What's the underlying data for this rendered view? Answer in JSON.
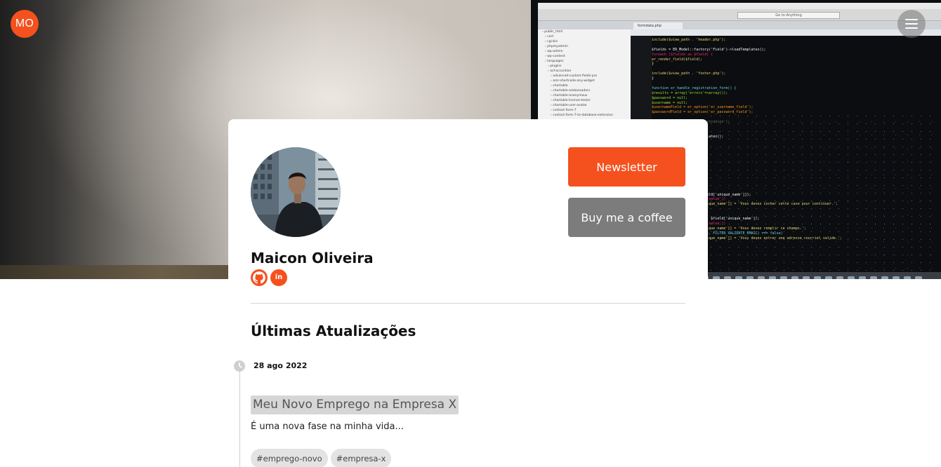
{
  "header": {
    "logo_initials": "MO",
    "menu_icon": "hamburger-menu-icon"
  },
  "hero": {
    "screen_menu": [
      "Komodo",
      "File",
      "Edit",
      "Code",
      "Navigation",
      "View",
      "Project",
      "Tools",
      "Help"
    ],
    "screen_search_placeholder": "Go to Anything",
    "screen_tab": "formdata.php",
    "screen_sidebar": [
      "public_html",
      "cert",
      "cgi-bin",
      "phpmyadmin",
      "wp-admin",
      "wp-content",
      "languages",
      "plugins",
      "acf-accordion",
      "advanced-custom-fields-pro",
      "amr-shortcode-any-widget",
      "chartable",
      "chartable-ambassadors",
      "chartable-anonymous",
      "chartable-license-tester",
      "chartable-user-avatar",
      "contact-form-7",
      "contact-form-7-to-database-extension"
    ],
    "screen_code": [
      {
        "text": "include($view_path . 'header.php');",
        "color": "#e6db74"
      },
      {
        "text": "",
        "color": "#ccc"
      },
      {
        "text": "$fields = ER_Model::factory('Field')->loadTemplates();",
        "color": "#f8f8f2"
      },
      {
        "text": "foreach ($fields as $field) {",
        "color": "#f92672"
      },
      {
        "text": "    er_render_field($field);",
        "color": "#e6db74"
      },
      {
        "text": "}",
        "color": "#f8f8f2"
      },
      {
        "text": "",
        "color": "#ccc"
      },
      {
        "text": "include($view_path . 'footer.php');",
        "color": "#e6db74"
      },
      {
        "text": "}",
        "color": "#f8f8f2"
      },
      {
        "text": "",
        "color": "#ccc"
      },
      {
        "text": "function er_handle_registration_form() {",
        "color": "#66d9ef"
      },
      {
        "text": "    $results = array('errors'=>array());",
        "color": "#a6e22e"
      },
      {
        "text": "    $password = null;",
        "color": "#a6e22e"
      },
      {
        "text": "    $username = null;",
        "color": "#a6e22e"
      },
      {
        "text": "    $usernameField = er_option('er_username_field');",
        "color": "#fd971f"
      },
      {
        "text": "    $passwordField = er_option('er_password_field');",
        "color": "#fd971f"
      },
      {
        "text": "",
        "color": "#ccc"
      },
      {
        "text": "    // ... odel::factory('Registration');",
        "color": "#75715e"
      },
      {
        "text": "             = date('Y-m-d H:i:s');",
        "color": "#e6db74"
      },
      {
        "text": "",
        "color": "#ccc"
      },
      {
        "text": "    factory('Field')->loadTemplates();",
        "color": "#f8f8f2"
      },
      {
        "text": "    $field) {",
        "color": "#f8f8f2"
      },
      {
        "text": "    ld'] = $field['id'];",
        "color": "#e6db74"
      },
      {
        "text": "    ull;",
        "color": "#f8f8f2"
      },
      {
        "text": "",
        "color": "#ccc"
      },
      {
        "text": "    nd validate'",
        "color": "#75715e"
      },
      {
        "text": "    'type']) {",
        "color": "#f8f8f2"
      },
      {
        "text": "",
        "color": "#ccc"
      },
      {
        "text": "    option':",
        "color": "#e6db74"
      },
      {
        "text": "",
        "color": "#ccc"
      },
      {
        "text": "",
        "color": "#ccc"
      },
      {
        "text": "    box':",
        "color": "#e6db74"
      },
      {
        "text": "    value'] = isset($_POST[$field['unique_name']]);",
        "color": "#f8f8f2"
      },
      {
        "text": "    ld['required'] && !$field['value'])",
        "color": "#f92672"
      },
      {
        "text": "    sults['errors'][$field['unique_name']] = 'Vous devez cocher cette case pour continuer.';",
        "color": "#e6db74"
      },
      {
        "text": "",
        "color": "#ccc"
      },
      {
        "text": "",
        "color": "#ccc"
      },
      {
        "text": "    'value'] = safe_get($_POST, $field['unique_name']);",
        "color": "#f8f8f2"
      },
      {
        "text": "    ld['required'] && !$field['value'])",
        "color": "#f92672"
      },
      {
        "text": "    sults['errors'][$field['unique_name']] = 'Vous devez remplir ce champs.';",
        "color": "#e6db74"
      },
      {
        "text": "    (filter_var($field['value'], FILTER_VALIDATE_EMAIL) === false)",
        "color": "#66d9ef"
      },
      {
        "text": "    sults['errors'][$field['unique_name']] = 'Vous devez entrer une adresse courriel valide.';",
        "color": "#e6db74"
      },
      {
        "text": "",
        "color": "#ccc"
      },
      {
        "text": "",
        "color": "#ccc"
      },
      {
        "text": "    word'",
        "color": "#e6db74"
      }
    ]
  },
  "profile": {
    "name": "Maicon Oliveira",
    "socials": [
      {
        "icon": "github-icon"
      },
      {
        "icon": "linkedin-icon",
        "glyph": "in"
      }
    ],
    "newsletter_label": "Newsletter",
    "coffee_label": "Buy me a coffee"
  },
  "updates": {
    "title": "Últimas Atualizações",
    "posts": [
      {
        "date": "28 ago 2022",
        "title": "Meu Novo Emprego na Empresa X",
        "excerpt": "É uma nova fase na minha vida...",
        "tags": [
          "#emprego-novo",
          "#empresa-x"
        ]
      }
    ]
  },
  "colors": {
    "accent": "#f4511e",
    "secondary_button": "#7c7c7c",
    "tag_bg": "#e3e3e3",
    "post_title_bg": "#d6d6d6"
  }
}
